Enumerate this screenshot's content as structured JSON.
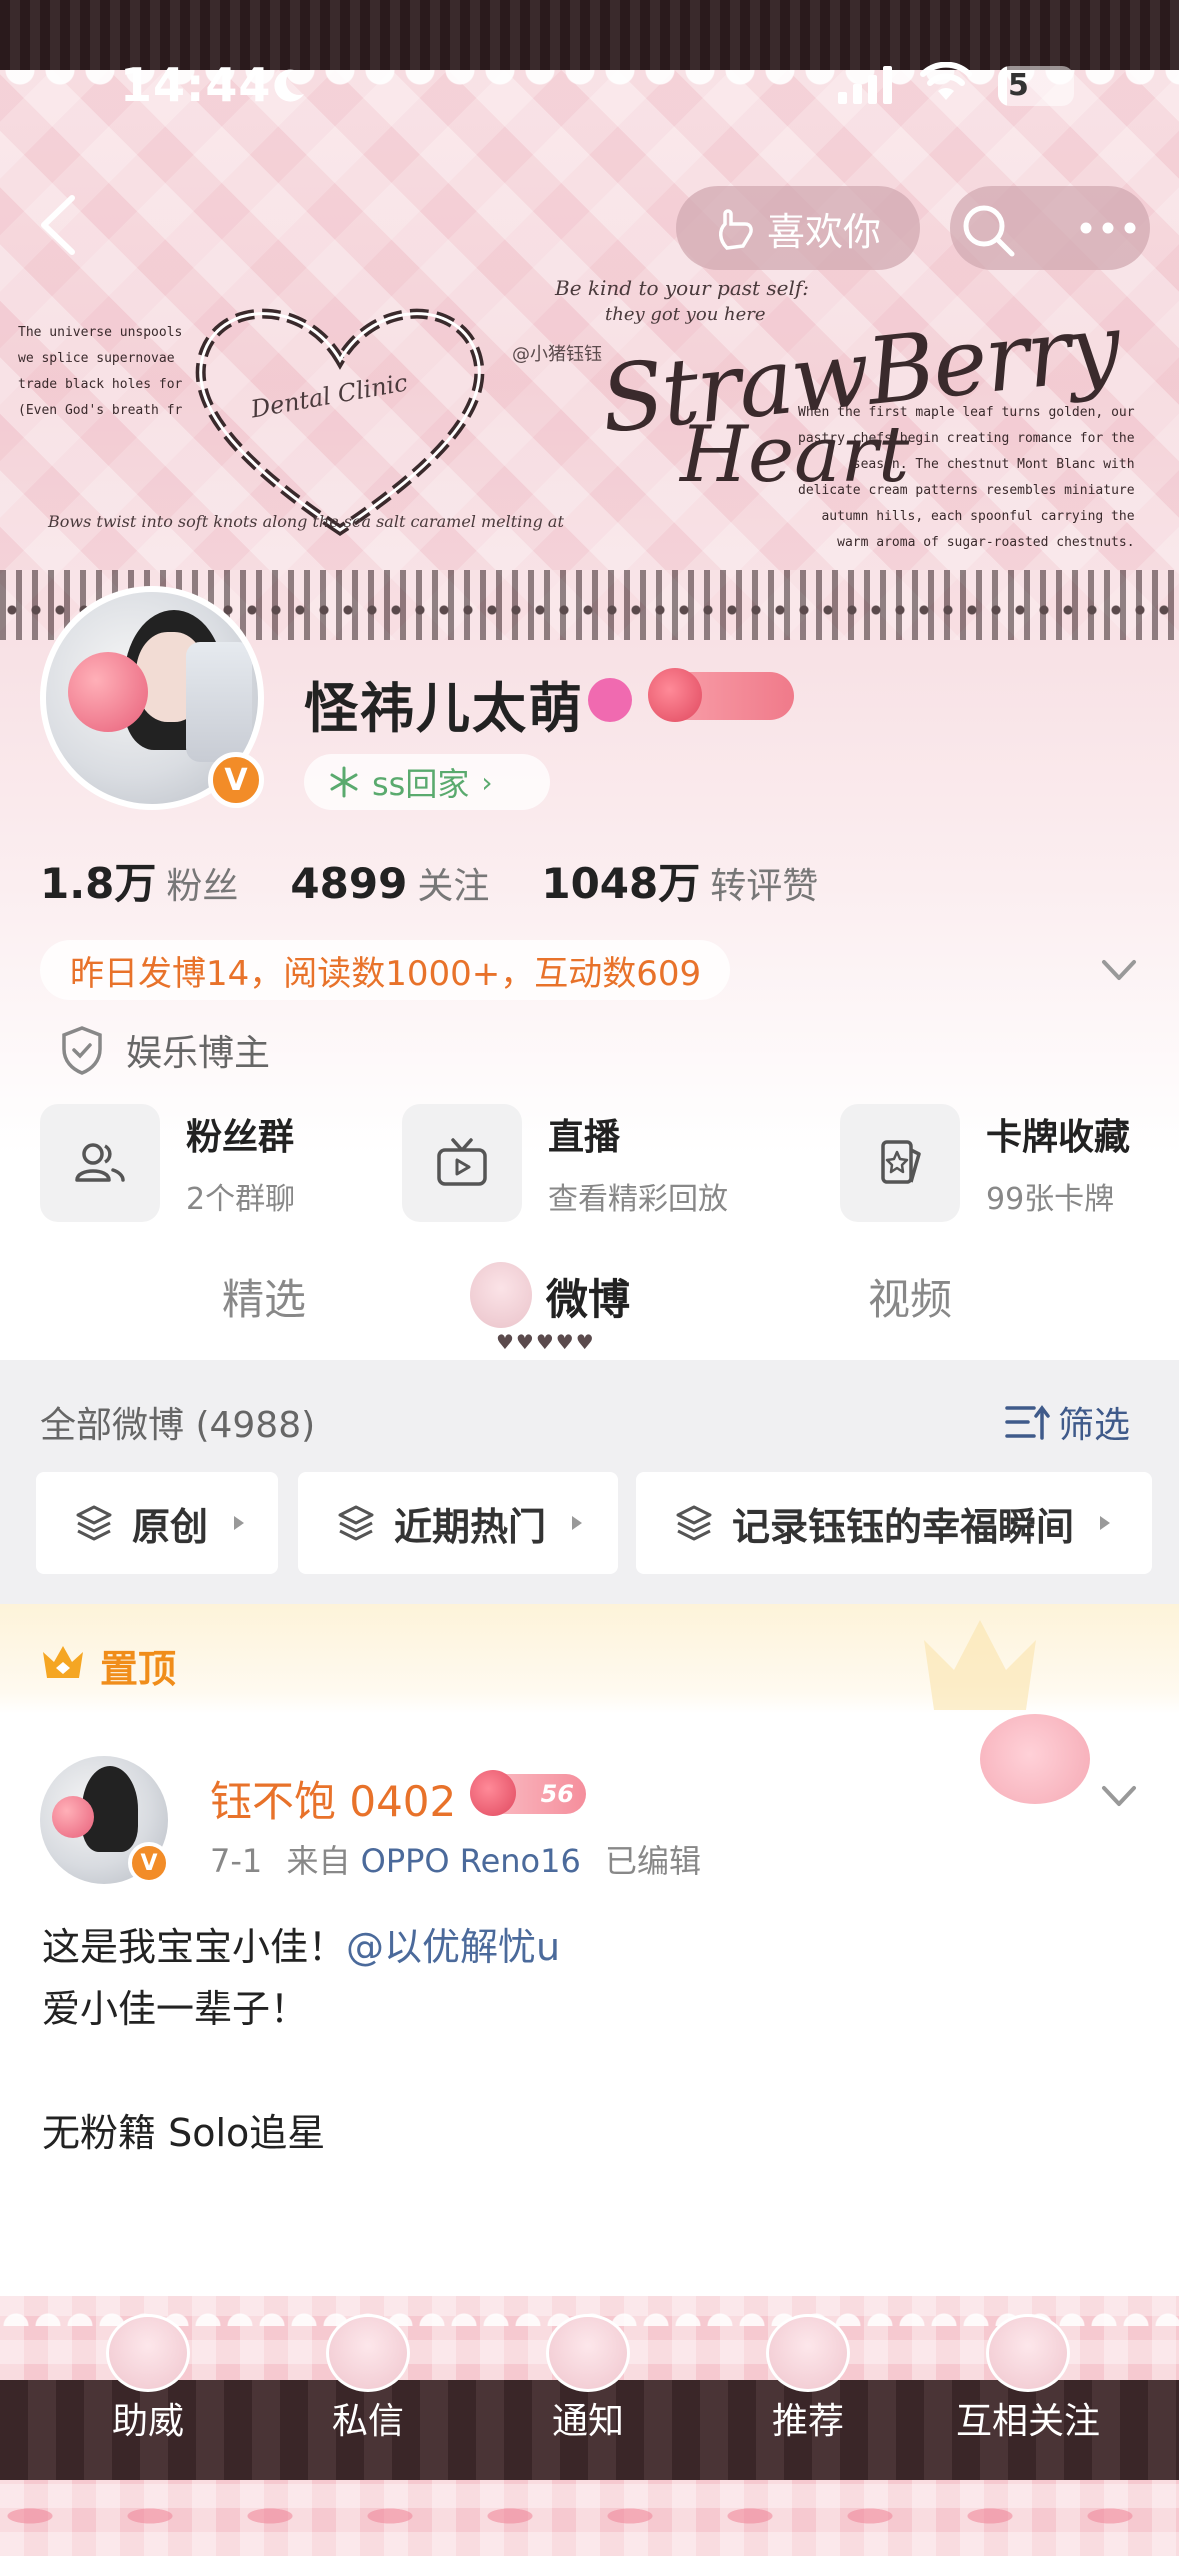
{
  "status_bar": {
    "time": "14:44",
    "battery_level": "5"
  },
  "header": {
    "like_button_label": "喜欢你",
    "banner": {
      "left_lines": [
        "The universe unspools",
        "we splice supernovae",
        "trade black holes for",
        "(Even God's breath fr"
      ],
      "clinic_label": "Dental Clinic",
      "tagline_top": "Be kind to your past self:",
      "tagline_sub": "they got you here",
      "watermark": "@小猪钰钰",
      "title_line1": "StrawBerry",
      "title_line2": "Heart",
      "right_lines": [
        "When the first maple leaf turns golden, our",
        "pastry chefs begin creating romance for the",
        "season. The chestnut Mont Blanc with",
        "delicate cream patterns resembles miniature",
        "autumn hills, each spoonful carrying the",
        "warm aroma of sugar-roasted chestnuts."
      ],
      "bottom_line": "Bows twist into soft knots along the sea salt caramel melting at"
    }
  },
  "profile": {
    "username": "怪祎儿太萌",
    "verified_mark": "V",
    "fan_club_label": "ss回家",
    "stats": [
      {
        "value": "1.8万",
        "label": "粉丝"
      },
      {
        "value": "4899",
        "label": "关注"
      },
      {
        "value": "1048万",
        "label": "转评赞"
      }
    ],
    "activity_summary": "昨日发博14，阅读数1000+，互动数609",
    "category": "娱乐博主",
    "features": [
      {
        "title": "粉丝群",
        "subtitle": "2个群聊",
        "icon": "group-icon"
      },
      {
        "title": "直播",
        "subtitle": "查看精彩回放",
        "icon": "tv-icon"
      },
      {
        "title": "卡牌收藏",
        "subtitle": "99张卡牌",
        "icon": "card-icon"
      }
    ]
  },
  "tabs": [
    {
      "label": "精选",
      "active": false
    },
    {
      "label": "微博",
      "active": true
    },
    {
      "label": "视频",
      "active": false
    }
  ],
  "filter": {
    "all_posts_label": "全部微博 (4988)",
    "filter_label": "筛选",
    "chips": [
      "原创",
      "近期热门",
      "记录钰钰的幸福瞬间"
    ]
  },
  "pinned": {
    "label": "置顶"
  },
  "post": {
    "author": "钰不饱 0402",
    "level": "56",
    "date": "7-1",
    "source_prefix": "来自",
    "device": "OPPO Reno16",
    "edited": "已编辑",
    "line1_text": "这是我宝宝小佳！",
    "line1_mention": "@以优解忧u",
    "line2": "爱小佳一辈子！",
    "line3": "无粉籍   Solo追星"
  },
  "bottom_nav": [
    "助威",
    "私信",
    "通知",
    "推荐",
    "互相关注"
  ],
  "colors": {
    "accent_orange": "#e8722a",
    "link_blue": "#4b6a9b",
    "banner_pink": "#f4d2d8",
    "dark_brown": "#3a2628"
  }
}
